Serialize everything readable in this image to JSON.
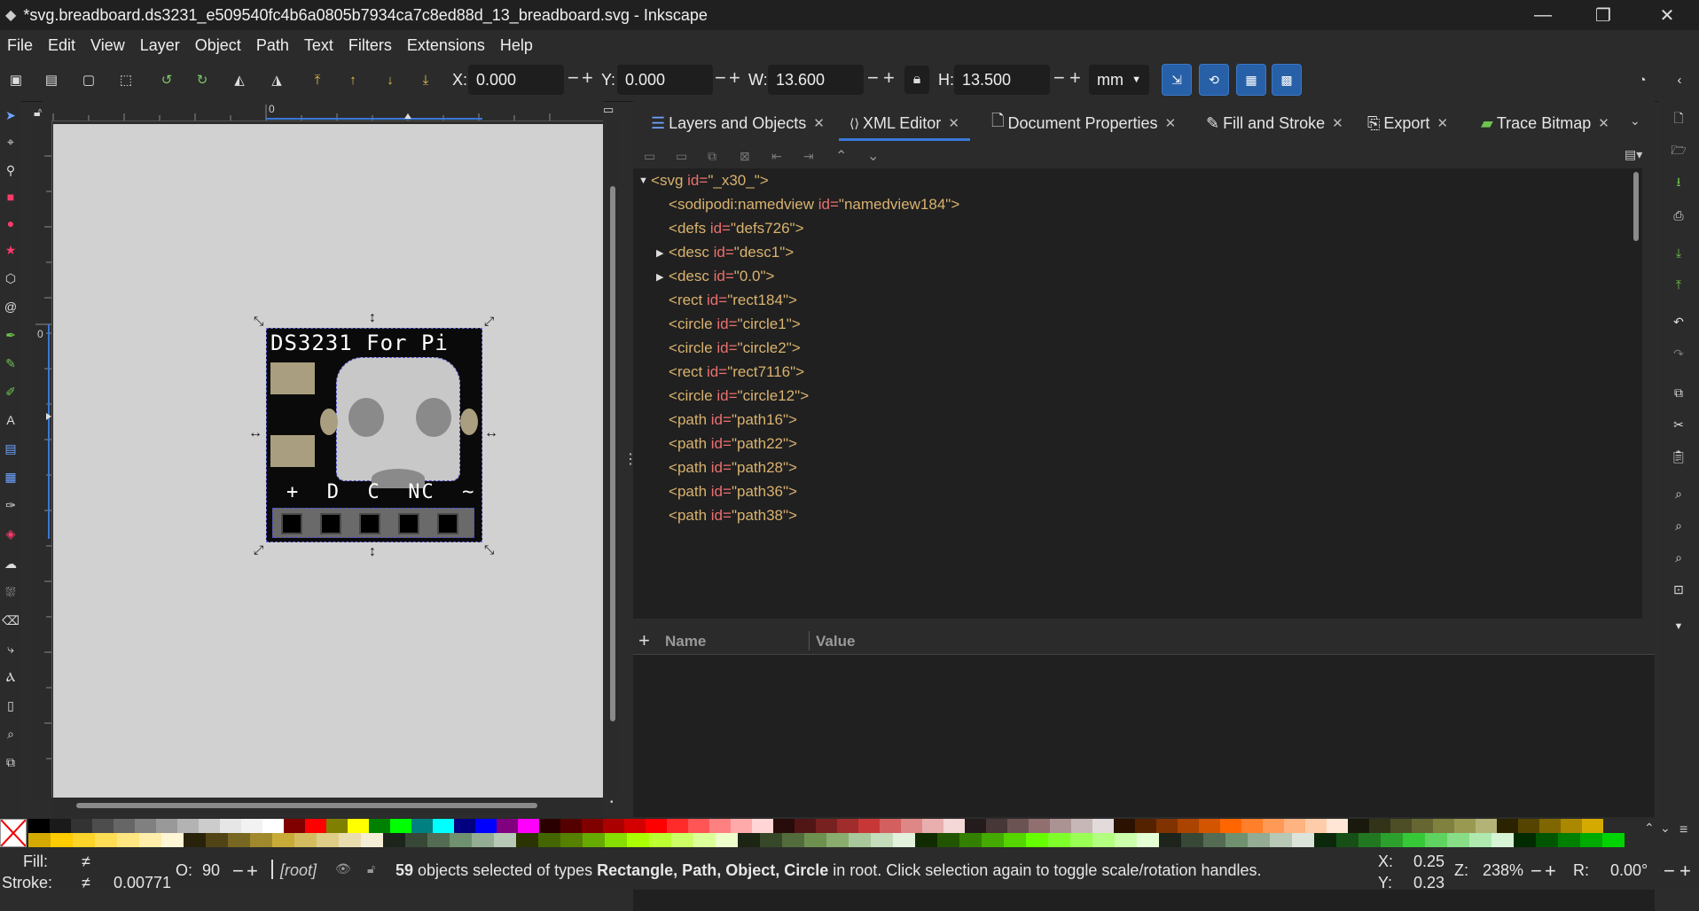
{
  "window": {
    "title": "*svg.breadboard.ds3231_e509540fc4b6a0805b7934ca7c8ed88d_13_breadboard.svg - Inkscape",
    "minimize": "—",
    "maximize": "❐",
    "close": "✕"
  },
  "menu": [
    "File",
    "Edit",
    "View",
    "Layer",
    "Object",
    "Path",
    "Text",
    "Filters",
    "Extensions",
    "Help"
  ],
  "toolbar": {
    "x_label": "X:",
    "x_value": "0.000",
    "y_label": "Y:",
    "y_value": "0.000",
    "w_label": "W:",
    "w_value": "13.600",
    "h_label": "H:",
    "h_value": "13.500",
    "unit": "mm",
    "minus": "−",
    "plus": "+"
  },
  "ruler": {
    "h_zero": "0",
    "v_zero": "0"
  },
  "canvas": {
    "pcb_title": "DS3231 For Pi",
    "pin_labels": "+  D  C  NC  ~"
  },
  "panel": {
    "tabs": [
      {
        "label": "Layers and Objects",
        "icon": "layers-icon",
        "active": false
      },
      {
        "label": "XML Editor",
        "icon": "xml-icon",
        "active": true
      },
      {
        "label": "Document Properties",
        "icon": "document-icon",
        "active": false
      },
      {
        "label": "Fill and Stroke",
        "icon": "fill-stroke-icon",
        "active": false
      },
      {
        "label": "Export",
        "icon": "export-icon",
        "active": false
      },
      {
        "label": "Trace Bitmap",
        "icon": "trace-icon",
        "active": false
      }
    ],
    "xml_nodes": [
      {
        "tag": "svg",
        "attr": "id",
        "value": "_x30_",
        "indent": 0,
        "expander": "open"
      },
      {
        "tag": "sodipodi:namedview",
        "attr": "id",
        "value": "namedview184",
        "indent": 1,
        "expander": "none"
      },
      {
        "tag": "defs",
        "attr": "id",
        "value": "defs726",
        "indent": 1,
        "expander": "none"
      },
      {
        "tag": "desc",
        "attr": "id",
        "value": "desc1",
        "indent": 1,
        "expander": "closed"
      },
      {
        "tag": "desc",
        "attr": "id",
        "value": "0.0",
        "indent": 1,
        "expander": "closed"
      },
      {
        "tag": "rect",
        "attr": "id",
        "value": "rect184",
        "indent": 1,
        "expander": "none"
      },
      {
        "tag": "circle",
        "attr": "id",
        "value": "circle1",
        "indent": 1,
        "expander": "none"
      },
      {
        "tag": "circle",
        "attr": "id",
        "value": "circle2",
        "indent": 1,
        "expander": "none"
      },
      {
        "tag": "rect",
        "attr": "id",
        "value": "rect7116",
        "indent": 1,
        "expander": "none"
      },
      {
        "tag": "circle",
        "attr": "id",
        "value": "circle12",
        "indent": 1,
        "expander": "none"
      },
      {
        "tag": "path",
        "attr": "id",
        "value": "path16",
        "indent": 1,
        "expander": "none"
      },
      {
        "tag": "path",
        "attr": "id",
        "value": "path22",
        "indent": 1,
        "expander": "none"
      },
      {
        "tag": "path",
        "attr": "id",
        "value": "path28",
        "indent": 1,
        "expander": "none"
      },
      {
        "tag": "path",
        "attr": "id",
        "value": "path36",
        "indent": 1,
        "expander": "none"
      },
      {
        "tag": "path",
        "attr": "id",
        "value": "path38",
        "indent": 1,
        "expander": "none"
      }
    ],
    "attr_add": "+",
    "attr_name_header": "Name",
    "attr_value_header": "Value"
  },
  "status": {
    "fill_label": "Fill:",
    "fill_value": "≠",
    "stroke_label": "Stroke:",
    "stroke_value": "≠",
    "stroke_width": "0.00771",
    "opacity_label": "O:",
    "opacity_value": "90",
    "layer": "[root]",
    "message_count": "59",
    "message_pre": " objects selected of types ",
    "types": "Rectangle, Path, Object, Circle",
    "message_post": " in root. Click selection again to toggle scale/rotation handles.",
    "cursor_x_label": "X:",
    "cursor_x": "0.25",
    "cursor_y_label": "Y:",
    "cursor_y": "0.23",
    "zoom_label": "Z:",
    "zoom": "238%",
    "rotation_label": "R:",
    "rotation": "0.00°"
  },
  "colors": {
    "accent": "#2860a8",
    "tag": "#d9b26f",
    "attr": "#ec6f6f",
    "canvas": "#d1d1d1"
  }
}
